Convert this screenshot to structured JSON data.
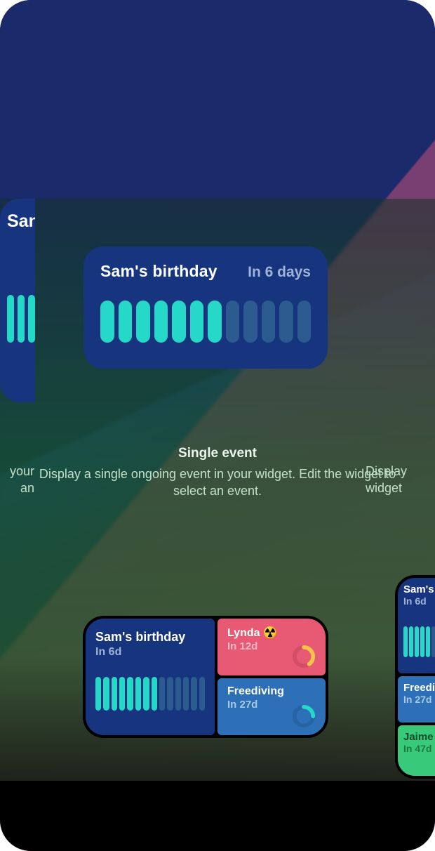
{
  "center_widget": {
    "title": "Sam's birthday",
    "sub": "In 6 days",
    "segments_total": 12,
    "segments_filled": 7
  },
  "right_peek_widget": {
    "title_fragment": "San",
    "segments_total": 3,
    "segments_filled": 3
  },
  "caption": {
    "title": "Single event",
    "body": "Display a single ongoing event in your widget. Edit the widget to select an event."
  },
  "caption_left": {
    "line1": "your",
    "line2": "an"
  },
  "caption_right": {
    "line1": "Display",
    "line2": "widget"
  },
  "medium_widget": {
    "primary": {
      "title": "Sam's birthday",
      "sub": "In 6d",
      "segments_total": 14,
      "segments_filled": 8
    },
    "top": {
      "title": "Lynda ☢️",
      "sub": "In 12d",
      "ring_color": "#f4c34a",
      "ring_pct": 40
    },
    "bottom": {
      "title": "Freediving",
      "sub": "In 27d",
      "ring_color": "#25d8c7",
      "ring_pct": 25
    }
  },
  "large_peek": {
    "r1": {
      "title": "Sam's",
      "sub": "In 6d"
    },
    "r2": {
      "title": "Freediv",
      "sub": "In 27d"
    },
    "r3": {
      "title": "Jaime -",
      "sub": "In 47d"
    }
  }
}
